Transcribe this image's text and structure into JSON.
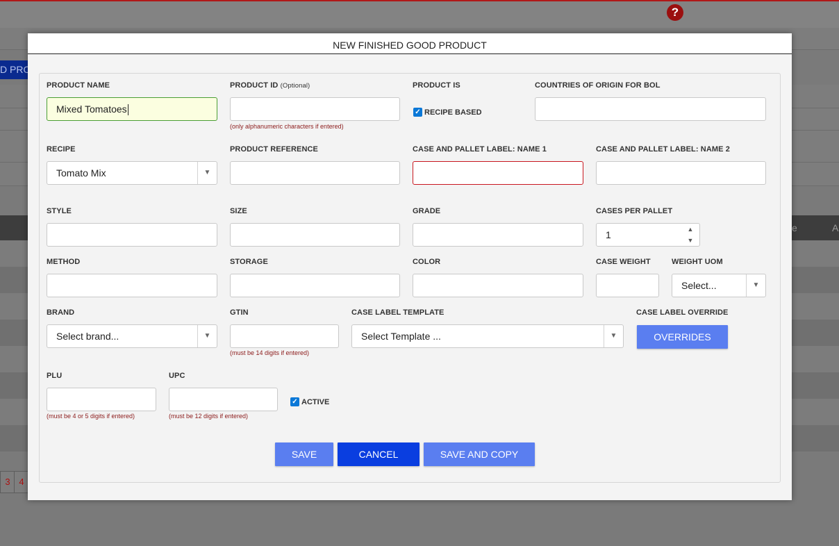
{
  "background": {
    "tab_label": "D PRO",
    "table_header_right": [
      "e",
      "A"
    ],
    "pagination": [
      "3",
      "4"
    ]
  },
  "modal": {
    "title": "NEW FINISHED GOOD PRODUCT",
    "fields": {
      "product_name": {
        "label": "PRODUCT NAME",
        "value": "Mixed Tomatoes"
      },
      "product_id": {
        "label": "PRODUCT ID",
        "optional": "(Optional)",
        "value": "",
        "hint": "(only alphanumeric characters if entered)"
      },
      "product_is": {
        "label": "PRODUCT IS",
        "checkbox_label": "RECIPE BASED",
        "checked": true
      },
      "countries": {
        "label": "COUNTRIES OF ORIGIN FOR BOL",
        "value": ""
      },
      "recipe": {
        "label": "RECIPE",
        "value": "Tomato Mix"
      },
      "product_reference": {
        "label": "PRODUCT REFERENCE",
        "value": ""
      },
      "pallet_name1": {
        "label": "CASE AND PALLET LABEL: NAME 1",
        "value": ""
      },
      "pallet_name2": {
        "label": "CASE AND PALLET LABEL: NAME 2",
        "value": ""
      },
      "style": {
        "label": "STYLE",
        "value": ""
      },
      "size": {
        "label": "SIZE",
        "value": ""
      },
      "grade": {
        "label": "GRADE",
        "value": ""
      },
      "cases_per_pallet": {
        "label": "CASES PER PALLET",
        "value": "1"
      },
      "method": {
        "label": "METHOD",
        "value": ""
      },
      "storage": {
        "label": "STORAGE",
        "value": ""
      },
      "color": {
        "label": "COLOR",
        "value": ""
      },
      "case_weight": {
        "label": "CASE WEIGHT",
        "value": ""
      },
      "weight_uom": {
        "label": "WEIGHT UOM",
        "value": "Select..."
      },
      "brand": {
        "label": "BRAND",
        "value": "Select brand..."
      },
      "gtin": {
        "label": "GTIN",
        "value": "",
        "hint": "(must be 14 digits if entered)"
      },
      "case_label_template": {
        "label": "CASE LABEL TEMPLATE",
        "value": "Select Template ..."
      },
      "case_label_override": {
        "label": "CASE LABEL OVERRIDE",
        "button": "OVERRIDES"
      },
      "plu": {
        "label": "PLU",
        "value": "",
        "hint": "(must be 4 or 5 digits if entered)"
      },
      "upc": {
        "label": "UPC",
        "value": "",
        "hint": "(must be 12 digits if entered)"
      },
      "active": {
        "checkbox_label": "ACTIVE",
        "checked": true
      }
    },
    "buttons": {
      "save": "SAVE",
      "cancel": "CANCEL",
      "save_and_copy": "SAVE AND COPY"
    }
  },
  "icons": {
    "help": "question-circle-icon",
    "dropdown": "caret-down-icon",
    "check": "checkmark-icon"
  },
  "colors": {
    "primary_button": "#5a7ef0",
    "cancel_button": "#0a3ee0",
    "error_border": "#c8161e",
    "hint_text": "#8b1a1a",
    "help_icon": "#9b0f0f"
  }
}
